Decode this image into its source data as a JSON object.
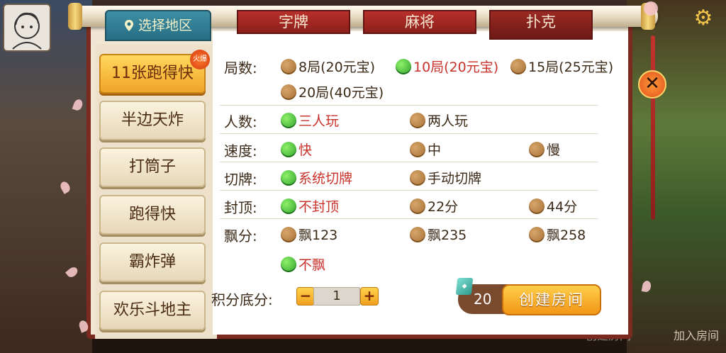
{
  "tabs": {
    "location": "选择地区",
    "items": [
      {
        "label": "字牌",
        "active": false
      },
      {
        "label": "麻将",
        "active": false
      },
      {
        "label": "扑克",
        "active": true
      }
    ]
  },
  "games": [
    {
      "label": "11张跑得快",
      "active": true,
      "badge": "火爆"
    },
    {
      "label": "半边天炸",
      "active": false
    },
    {
      "label": "打筒子",
      "active": false
    },
    {
      "label": "跑得快",
      "active": false
    },
    {
      "label": "霸炸弹",
      "active": false
    },
    {
      "label": "欢乐斗地主",
      "active": false
    }
  ],
  "options": {
    "rounds": {
      "label": "局数:",
      "choices": [
        "8局(20元宝)",
        "10局(20元宝)",
        "15局(25元宝)",
        "20局(40元宝)"
      ],
      "selected": 1
    },
    "players": {
      "label": "人数:",
      "choices": [
        "三人玩",
        "两人玩"
      ],
      "selected": 0
    },
    "speed": {
      "label": "速度:",
      "choices": [
        "快",
        "中",
        "慢"
      ],
      "selected": 0
    },
    "shuffle": {
      "label": "切牌:",
      "choices": [
        "系统切牌",
        "手动切牌"
      ],
      "selected": 0
    },
    "cap": {
      "label": "封顶:",
      "choices": [
        "不封顶",
        "22分",
        "44分"
      ],
      "selected": 0
    },
    "float": {
      "label": "飘分:",
      "choices": [
        "飘123",
        "飘235",
        "飘258",
        "不飘"
      ],
      "selected": 3
    }
  },
  "base_score": {
    "label": "积分底分:",
    "value": "1",
    "minus": "−",
    "plus": "+"
  },
  "cost": "20",
  "create_button": "创建房间",
  "background": {
    "join_room": "加入房间",
    "create_room": "创建房间"
  },
  "colors": {
    "accent_red": "#c8322b",
    "selected_green": "#2da02a",
    "frame_red": "#7a2a1e",
    "gold": "#f0a528"
  }
}
